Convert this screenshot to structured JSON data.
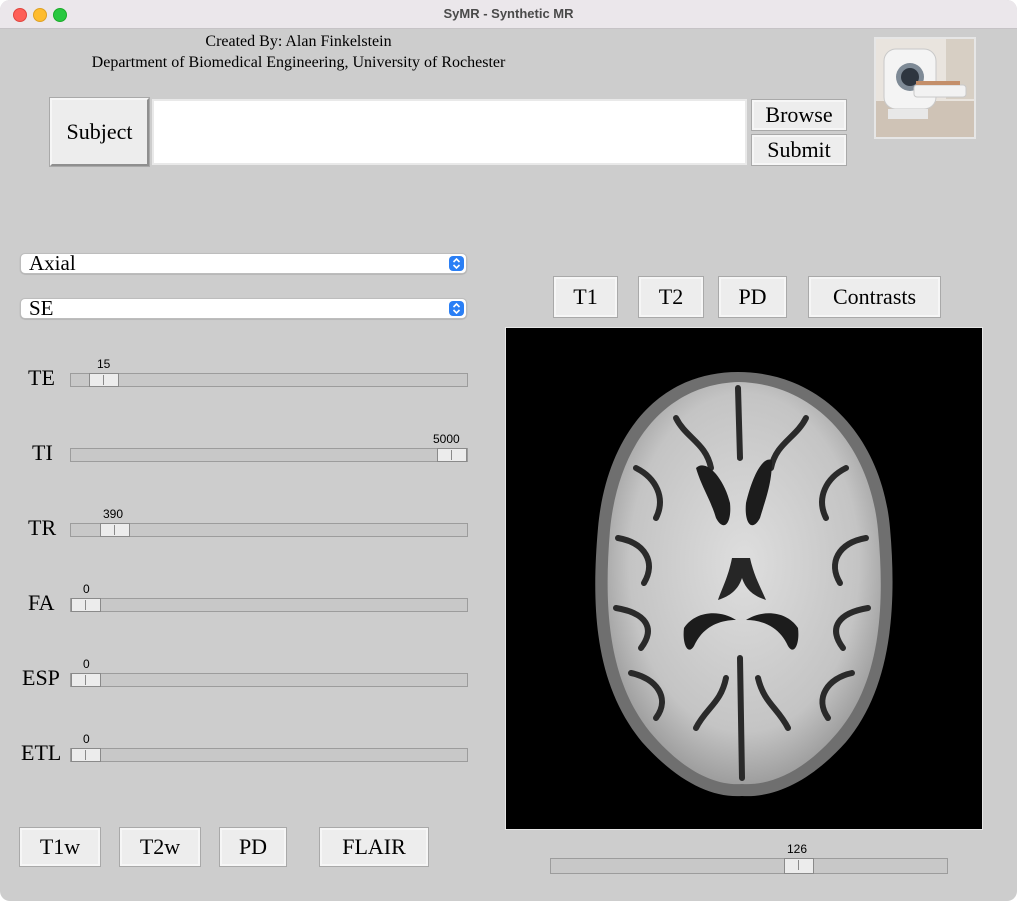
{
  "window": {
    "title": "SyMR - Synthetic MR"
  },
  "credits": {
    "line1": "Created By: Alan Finkelstein",
    "line2": "Department of Biomedical Engineering, University of Rochester"
  },
  "subject": {
    "button_label": "Subject",
    "input_value": "",
    "browse_label": "Browse",
    "submit_label": "Submit"
  },
  "selects": {
    "orientation": "Axial",
    "sequence": "SE"
  },
  "sliders": [
    {
      "label": "TE",
      "value": "15"
    },
    {
      "label": "TI",
      "value": "5000"
    },
    {
      "label": "TR",
      "value": "390"
    },
    {
      "label": "FA",
      "value": "0"
    },
    {
      "label": "ESP",
      "value": "0"
    },
    {
      "label": "ETL",
      "value": "0"
    }
  ],
  "map_buttons": [
    "T1",
    "T2",
    "PD",
    "Contrasts"
  ],
  "preset_buttons": [
    "T1w",
    "T2w",
    "PD",
    "FLAIR"
  ],
  "slice_slider": {
    "value": "126"
  },
  "icons": {
    "select_chevron": "up-down-chevron-icon",
    "thumbnail": "mri-scanner-photo"
  },
  "colors": {
    "window_bg": "#cdcdcd",
    "accent": "#2a7ff5",
    "image_bg": "#000000"
  }
}
